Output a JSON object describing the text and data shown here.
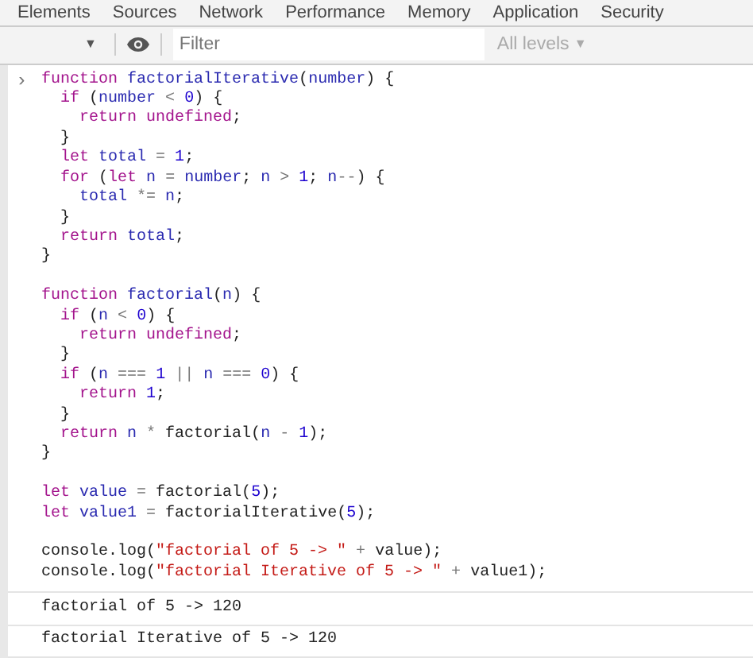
{
  "tabs": [
    {
      "label": "Elements",
      "selected": false
    },
    {
      "label": "Sources",
      "selected": false
    },
    {
      "label": "Network",
      "selected": false
    },
    {
      "label": "Performance",
      "selected": false
    },
    {
      "label": "Memory",
      "selected": false
    },
    {
      "label": "Application",
      "selected": false
    },
    {
      "label": "Security",
      "selected": false
    }
  ],
  "toolbar": {
    "context_caret": "▼",
    "filter": {
      "placeholder": "Filter"
    },
    "levels": {
      "label": "All levels",
      "caret": "▼"
    }
  },
  "input": {
    "prompt": "›",
    "blocks": [
      [
        [
          {
            "kind": "keyword",
            "text": "function"
          },
          {
            "kind": "name",
            "text": " factorialIterative"
          },
          {
            "kind": "plain",
            "text": "("
          },
          {
            "kind": "name",
            "text": "number"
          },
          {
            "kind": "plain",
            "text": ") {"
          }
        ],
        [
          {
            "kind": "keyword",
            "text": "  if"
          },
          {
            "kind": "plain",
            "text": " ("
          },
          {
            "kind": "name",
            "text": "number"
          },
          {
            "kind": "operator",
            "text": " <"
          },
          {
            "kind": "number",
            "text": " 0"
          },
          {
            "kind": "plain",
            "text": ") {"
          }
        ],
        [
          {
            "kind": "keyword",
            "text": "    return undefined"
          },
          {
            "kind": "plain",
            "text": ";"
          }
        ],
        [
          {
            "kind": "plain",
            "text": "  }"
          }
        ],
        [
          {
            "kind": "keyword",
            "text": "  let"
          },
          {
            "kind": "name",
            "text": " total"
          },
          {
            "kind": "operator",
            "text": " ="
          },
          {
            "kind": "number",
            "text": " 1"
          },
          {
            "kind": "plain",
            "text": ";"
          }
        ],
        [
          {
            "kind": "keyword",
            "text": "  for"
          },
          {
            "kind": "plain",
            "text": " ("
          },
          {
            "kind": "keyword",
            "text": "let"
          },
          {
            "kind": "name",
            "text": " n"
          },
          {
            "kind": "operator",
            "text": " ="
          },
          {
            "kind": "name",
            "text": " number"
          },
          {
            "kind": "plain",
            "text": ";"
          },
          {
            "kind": "name",
            "text": " n"
          },
          {
            "kind": "operator",
            "text": " >"
          },
          {
            "kind": "number",
            "text": " 1"
          },
          {
            "kind": "plain",
            "text": ";"
          },
          {
            "kind": "name",
            "text": " n"
          },
          {
            "kind": "operator",
            "text": "--"
          },
          {
            "kind": "plain",
            "text": ") {"
          }
        ],
        [
          {
            "kind": "name",
            "text": "    total"
          },
          {
            "kind": "operator",
            "text": " *="
          },
          {
            "kind": "name",
            "text": " n"
          },
          {
            "kind": "plain",
            "text": ";"
          }
        ],
        [
          {
            "kind": "plain",
            "text": "  }"
          }
        ],
        [
          {
            "kind": "keyword",
            "text": "  return"
          },
          {
            "kind": "name",
            "text": " total"
          },
          {
            "kind": "plain",
            "text": ";"
          }
        ],
        [
          {
            "kind": "plain",
            "text": "}"
          }
        ]
      ],
      [
        [
          {
            "kind": "keyword",
            "text": "function"
          },
          {
            "kind": "name",
            "text": " factorial"
          },
          {
            "kind": "plain",
            "text": "("
          },
          {
            "kind": "name",
            "text": "n"
          },
          {
            "kind": "plain",
            "text": ") {"
          }
        ],
        [
          {
            "kind": "keyword",
            "text": "  if"
          },
          {
            "kind": "plain",
            "text": " ("
          },
          {
            "kind": "name",
            "text": "n"
          },
          {
            "kind": "operator",
            "text": " <"
          },
          {
            "kind": "number",
            "text": " 0"
          },
          {
            "kind": "plain",
            "text": ") {"
          }
        ],
        [
          {
            "kind": "keyword",
            "text": "    return undefined"
          },
          {
            "kind": "plain",
            "text": ";"
          }
        ],
        [
          {
            "kind": "plain",
            "text": "  }"
          }
        ],
        [
          {
            "kind": "keyword",
            "text": "  if"
          },
          {
            "kind": "plain",
            "text": " ("
          },
          {
            "kind": "name",
            "text": "n"
          },
          {
            "kind": "operator",
            "text": " ==="
          },
          {
            "kind": "number",
            "text": " 1"
          },
          {
            "kind": "operator",
            "text": " ||"
          },
          {
            "kind": "name",
            "text": " n"
          },
          {
            "kind": "operator",
            "text": " ==="
          },
          {
            "kind": "number",
            "text": " 0"
          },
          {
            "kind": "plain",
            "text": ") {"
          }
        ],
        [
          {
            "kind": "keyword",
            "text": "    return"
          },
          {
            "kind": "number",
            "text": " 1"
          },
          {
            "kind": "plain",
            "text": ";"
          }
        ],
        [
          {
            "kind": "plain",
            "text": "  }"
          }
        ],
        [
          {
            "kind": "keyword",
            "text": "  return"
          },
          {
            "kind": "name",
            "text": " n"
          },
          {
            "kind": "operator",
            "text": " *"
          },
          {
            "kind": "plain",
            "text": " factorial("
          },
          {
            "kind": "name",
            "text": "n"
          },
          {
            "kind": "operator",
            "text": " -"
          },
          {
            "kind": "number",
            "text": " 1"
          },
          {
            "kind": "plain",
            "text": ");"
          }
        ],
        [
          {
            "kind": "plain",
            "text": "}"
          }
        ]
      ],
      [
        [
          {
            "kind": "keyword",
            "text": "let"
          },
          {
            "kind": "name",
            "text": " value"
          },
          {
            "kind": "operator",
            "text": " ="
          },
          {
            "kind": "plain",
            "text": " factorial("
          },
          {
            "kind": "number",
            "text": "5"
          },
          {
            "kind": "plain",
            "text": ");"
          }
        ],
        [
          {
            "kind": "keyword",
            "text": "let"
          },
          {
            "kind": "name",
            "text": " value1"
          },
          {
            "kind": "operator",
            "text": " ="
          },
          {
            "kind": "plain",
            "text": " factorialIterative("
          },
          {
            "kind": "number",
            "text": "5"
          },
          {
            "kind": "plain",
            "text": ");"
          }
        ]
      ],
      [
        [
          {
            "kind": "plain",
            "text": "console.log("
          },
          {
            "kind": "string",
            "text": "\"factorial of 5 -> \""
          },
          {
            "kind": "operator",
            "text": " +"
          },
          {
            "kind": "plain",
            "text": " value);"
          }
        ],
        [
          {
            "kind": "plain",
            "text": "console.log("
          },
          {
            "kind": "string",
            "text": "\"factorial Iterative of 5 -> \""
          },
          {
            "kind": "operator",
            "text": " +"
          },
          {
            "kind": "plain",
            "text": " value1);"
          }
        ]
      ]
    ]
  },
  "output": [
    "factorial of 5 -> 120",
    "factorial Iterative of 5 -> 120"
  ]
}
